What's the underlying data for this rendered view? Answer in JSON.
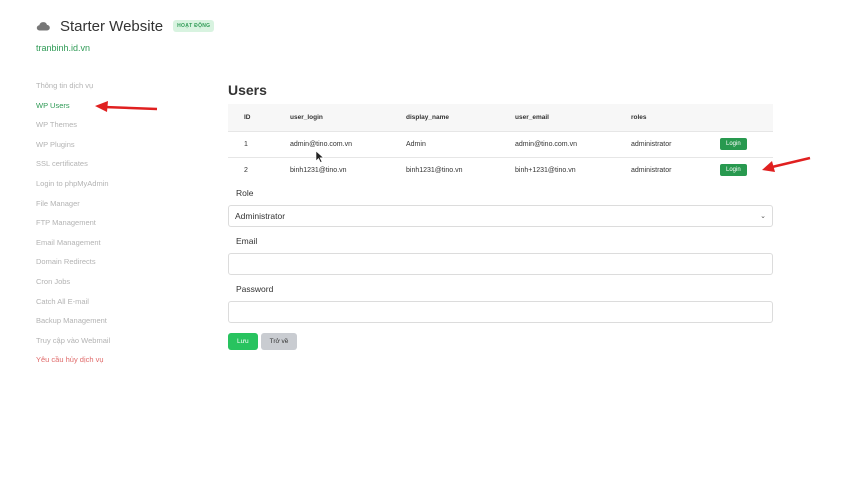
{
  "header": {
    "title": "Starter Website",
    "status": "HOẠT ĐỘNG",
    "domain": "tranbinh.id.vn"
  },
  "sidebar": {
    "items": [
      {
        "label": "Thông tin dịch vụ",
        "state": "normal"
      },
      {
        "label": "WP Users",
        "state": "active"
      },
      {
        "label": "WP Themes",
        "state": "normal"
      },
      {
        "label": "WP Plugins",
        "state": "normal"
      },
      {
        "label": "SSL certificates",
        "state": "normal"
      },
      {
        "label": "Login to phpMyAdmin",
        "state": "normal"
      },
      {
        "label": "File Manager",
        "state": "normal"
      },
      {
        "label": "FTP Management",
        "state": "normal"
      },
      {
        "label": "Email Management",
        "state": "normal"
      },
      {
        "label": "Domain Redirects",
        "state": "normal"
      },
      {
        "label": "Cron Jobs",
        "state": "normal"
      },
      {
        "label": "Catch All E-mail",
        "state": "normal"
      },
      {
        "label": "Backup Management",
        "state": "normal"
      },
      {
        "label": "Truy cập vào Webmail",
        "state": "normal"
      },
      {
        "label": "Yêu cầu hủy dịch vụ",
        "state": "danger"
      }
    ]
  },
  "main": {
    "title": "Users",
    "table": {
      "columns": [
        "ID",
        "user_login",
        "display_name",
        "user_email",
        "roles"
      ],
      "rows": [
        {
          "id": "1",
          "user_login": "admin@tino.com.vn",
          "display_name": "Admin",
          "user_email": "admin@tino.com.vn",
          "roles": "administrator",
          "action": "Login"
        },
        {
          "id": "2",
          "user_login": "binh1231@tino.vn",
          "display_name": "binh1231@tino.vn",
          "user_email": "binh+1231@tino.vn",
          "roles": "administrator",
          "action": "Login"
        }
      ]
    },
    "form": {
      "role_label": "Role",
      "role_value": "Administrator",
      "email_label": "Email",
      "email_value": "",
      "password_label": "Password",
      "password_value": "",
      "save_label": "Lưu",
      "back_label": "Trở về"
    }
  },
  "colors": {
    "accent": "#2e9a55",
    "button": "#28994f",
    "save": "#28c35f",
    "annotation": "#e02020",
    "danger": "#e06a6a"
  },
  "icons": {
    "logo": "cloud-icon",
    "select": "chevron-down-icon",
    "cursor": "mouse-cursor-icon"
  }
}
